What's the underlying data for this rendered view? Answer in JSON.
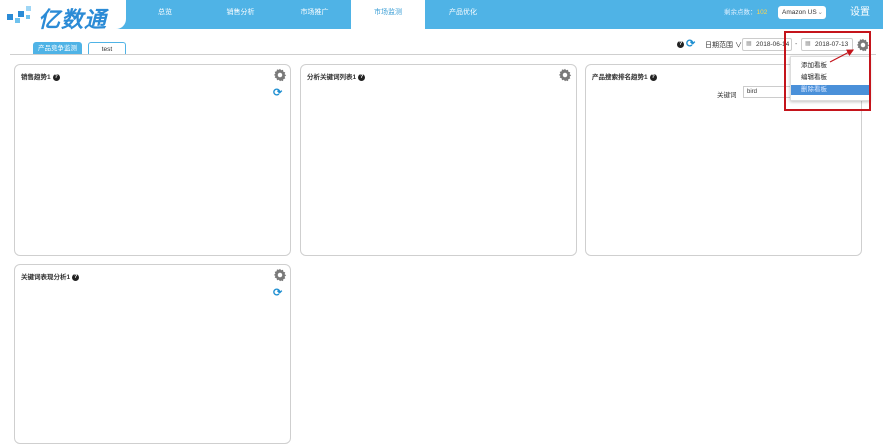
{
  "header": {
    "logo_text": "亿数通",
    "nav": [
      {
        "label": "总览"
      },
      {
        "label": "销售分析"
      },
      {
        "label": "市场推广"
      },
      {
        "label": "市场监测"
      },
      {
        "label": "产品优化"
      }
    ],
    "credits_label": "剩余点数：",
    "credits_value": "102",
    "market_select": "Amazon US",
    "settings_label": "设置"
  },
  "tabs": [
    {
      "label": "产品竞争监测"
    },
    {
      "label": "test"
    }
  ],
  "toolbar": {
    "help": "?",
    "date_range_label": "日期范围",
    "date_range_caret": "∨",
    "start_date": "2018-06-14",
    "end_date": "2018-07-13",
    "separator": "-"
  },
  "dropdown_menu": {
    "items": [
      {
        "label": "添加看板"
      },
      {
        "label": "编辑看板"
      },
      {
        "label": "删除看板"
      }
    ]
  },
  "panels": [
    {
      "title": "销售趋势1"
    },
    {
      "title": "分析关键词列表1"
    },
    {
      "title": "产品搜索排名趋势1"
    },
    {
      "title": "关键词表现分析1"
    }
  ],
  "ranking_panel": {
    "keyword_label": "关键词",
    "keyword_value": "bird"
  },
  "colors": {
    "header_bg": "#4fb3e6",
    "accent": "#1f8fd1",
    "highlight_box": "#c4141b",
    "menu_selected": "#4a90d9"
  }
}
